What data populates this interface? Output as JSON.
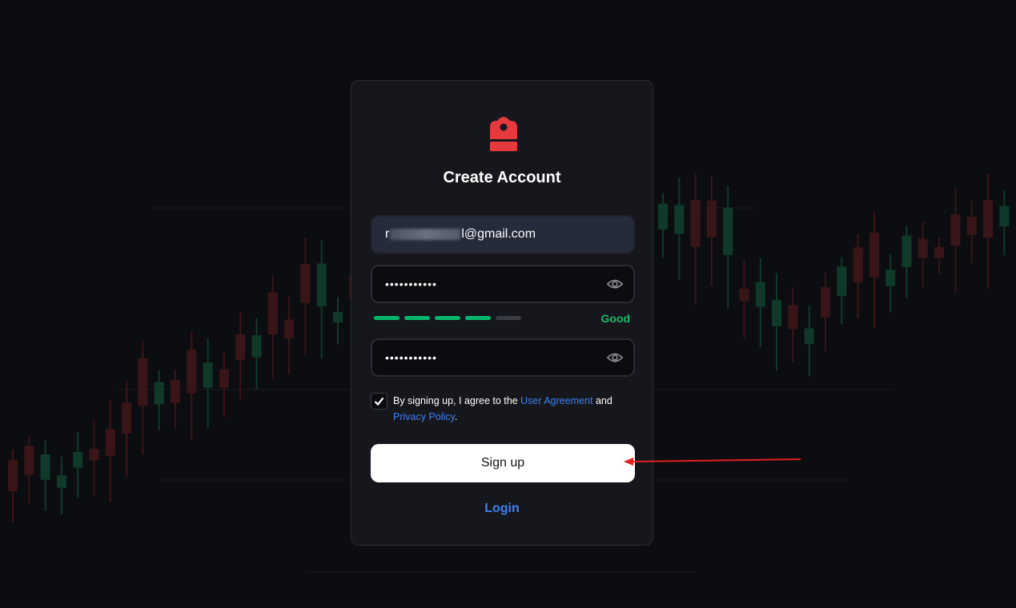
{
  "colors": {
    "accent": "#e5393d",
    "link": "#3c82f6",
    "strength_good": "#1db96b",
    "background": "#0c0d10",
    "card": "#16171c"
  },
  "logo": {
    "icon": "lock-icon"
  },
  "title": "Create Account",
  "email": {
    "prefix": "r",
    "suffix": "l@gmail.com"
  },
  "password": {
    "value": "•••••••••••",
    "icon": "eye-icon"
  },
  "confirm_password": {
    "value": "•••••••••••",
    "icon": "eye-icon"
  },
  "strength": {
    "level": 4,
    "of": 5,
    "label": "Good"
  },
  "terms": {
    "checked": true,
    "text_before": "By signing up, I agree to the ",
    "link1": "User Agreement",
    "text_middle": " and ",
    "link2": "Privacy Policy",
    "text_after": "."
  },
  "signup_label": "Sign up",
  "login_label": "Login"
}
